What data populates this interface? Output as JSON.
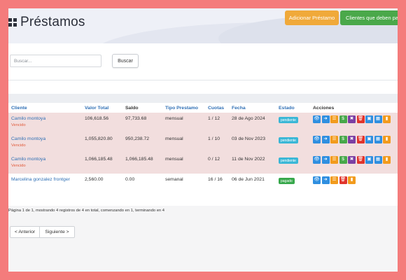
{
  "header": {
    "title": "Préstamos",
    "add_button": "Adicionar Préstamo",
    "debt_button": "Clientes que deben pagar"
  },
  "search": {
    "placeholder": "Buscar...",
    "button": "Buscar"
  },
  "table": {
    "columns": [
      "Cliente",
      "Valor Total",
      "Saldo",
      "Tipo Prestamo",
      "Cuotas",
      "Fecha",
      "Estado",
      "Acciones"
    ],
    "rows": [
      {
        "cliente": "Camilo montoya",
        "vencido": "Vencido",
        "valor_total": "106,618.56",
        "saldo": "97,733.68",
        "tipo": "mensual",
        "cuotas": "1 / 12",
        "fecha": "28 de Ago 2024",
        "estado": "pendiente",
        "status_color": "#3bb7d6",
        "overdue": true
      },
      {
        "cliente": "Camilo montoya",
        "vencido": "Vencido",
        "valor_total": "1,055,820.80",
        "saldo": "950,238.72",
        "tipo": "mensual",
        "cuotas": "1 / 10",
        "fecha": "03 de Nov 2023",
        "estado": "pendiente",
        "status_color": "#3bb7d6",
        "overdue": true
      },
      {
        "cliente": "Camilo montoya",
        "vencido": "Vencido",
        "valor_total": "1,066,185.48",
        "saldo": "1,066,185.48",
        "tipo": "mensual",
        "cuotas": "0 / 12",
        "fecha": "11 de Nov 2022",
        "estado": "pendiente",
        "status_color": "#3bb7d6",
        "overdue": true
      },
      {
        "cliente": "Marcelina gonzalez frontger",
        "vencido": "",
        "valor_total": "2,560.00",
        "saldo": "0.00",
        "tipo": "semanal",
        "cuotas": "16 / 16",
        "fecha": "06 de Jun 2021",
        "estado": "pagado",
        "status_color": "#38a84c",
        "overdue": false
      }
    ],
    "actions_full": [
      {
        "icon": "eye-icon",
        "glyph": "👁",
        "color": "blue"
      },
      {
        "icon": "arrow-right-icon",
        "glyph": "➜",
        "color": "blue"
      },
      {
        "icon": "list-icon",
        "glyph": "☰",
        "color": "orange"
      },
      {
        "icon": "dollar-icon",
        "glyph": "$",
        "color": "green"
      },
      {
        "icon": "close-icon",
        "glyph": "✖",
        "color": "purple"
      },
      {
        "icon": "trash-icon",
        "glyph": "🗑",
        "color": "red"
      },
      {
        "icon": "briefcase-icon",
        "glyph": "▣",
        "color": "blue"
      },
      {
        "icon": "calendar-icon",
        "glyph": "▦",
        "color": "blue"
      },
      {
        "icon": "file-icon",
        "glyph": "▮",
        "color": "orange"
      }
    ],
    "actions_paid": [
      {
        "icon": "eye-icon",
        "glyph": "👁",
        "color": "blue"
      },
      {
        "icon": "arrow-right-icon",
        "glyph": "➜",
        "color": "blue"
      },
      {
        "icon": "list-icon",
        "glyph": "☰",
        "color": "orange"
      },
      {
        "icon": "trash-icon",
        "glyph": "🗑",
        "color": "red"
      },
      {
        "icon": "file-icon",
        "glyph": "▮",
        "color": "orange"
      }
    ]
  },
  "pagination": {
    "info": "Página 1 de 1, mostrando 4 registros de 4 en total, comenzando en 1, terminando en 4",
    "prev": "< Anterior",
    "next": "Siguiente >"
  }
}
